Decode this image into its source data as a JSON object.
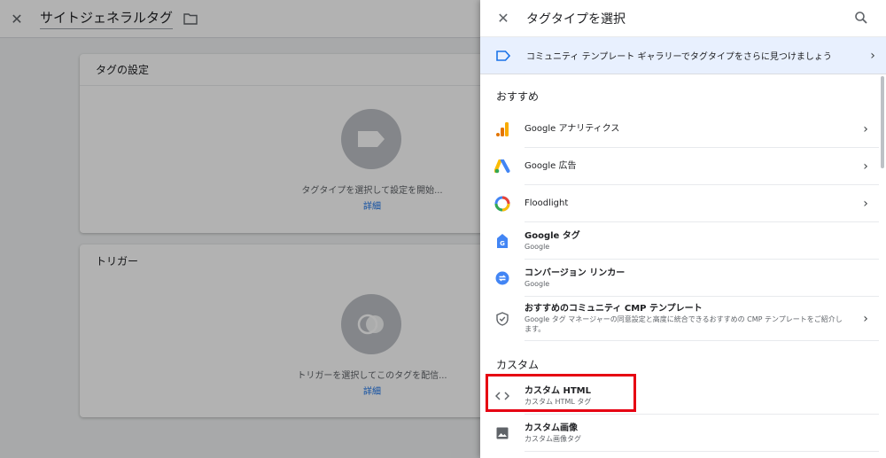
{
  "editor": {
    "title": "サイトジェネラルタグ",
    "tag_card": {
      "header": "タグの設定",
      "hint": "タグタイプを選択して設定を開始...",
      "link": "詳細"
    },
    "trigger_card": {
      "header": "トリガー",
      "hint": "トリガーを選択してこのタグを配信...",
      "link": "詳細"
    }
  },
  "panel": {
    "title": "タグタイプを選択",
    "banner_text": "コミュニティ テンプレート ギャラリーでタグタイプをさらに見つけましょう",
    "sections": {
      "recommended": "おすすめ",
      "custom": "カスタム"
    },
    "recommended_items": [
      {
        "name": "Google アナリティクス",
        "sub": "",
        "icon": "analytics-icon",
        "chevron": true
      },
      {
        "name": "Google 広告",
        "sub": "",
        "icon": "google-ads-icon",
        "chevron": true
      },
      {
        "name": "Floodlight",
        "sub": "",
        "icon": "floodlight-icon",
        "chevron": true
      },
      {
        "name": "Google タグ",
        "sub": "Google",
        "icon": "google-tag-icon",
        "chevron": false
      },
      {
        "name": "コンバージョン リンカー",
        "sub": "Google",
        "icon": "conversion-linker-icon",
        "chevron": false
      },
      {
        "name": "おすすめのコミュニティ CMP テンプレート",
        "sub": "Google タグ マネージャーの同意設定と高度に統合できるおすすめの CMP テンプレートをご紹介します。",
        "icon": "shield-check-icon",
        "chevron": true
      }
    ],
    "custom_items": [
      {
        "name": "カスタム HTML",
        "sub": "カスタム HTML タグ",
        "icon": "code-icon"
      },
      {
        "name": "カスタム画像",
        "sub": "カスタム画像タグ",
        "icon": "image-icon"
      }
    ]
  },
  "colors": {
    "accent": "#1a73e8",
    "banner_bg": "#e8f0fe",
    "highlight": "#e60012",
    "analytics_orange": "#f9ab00",
    "ads_blue": "#4285f4",
    "ads_yellow": "#fbbc04",
    "ads_green": "#34a853"
  }
}
